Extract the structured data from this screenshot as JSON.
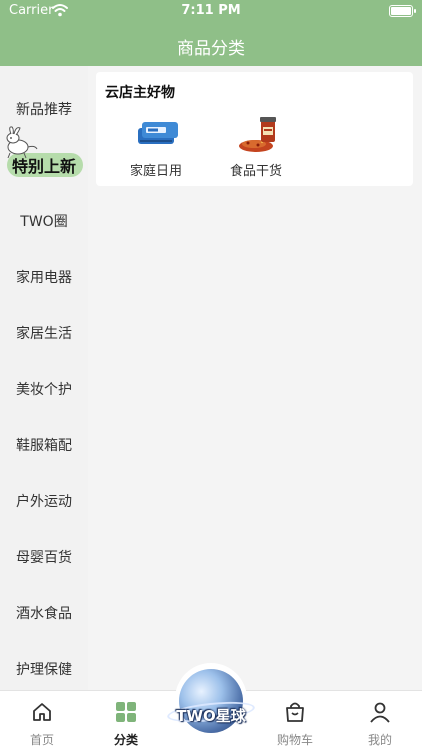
{
  "status_bar": {
    "carrier": "Carrier",
    "time": "7:11 PM"
  },
  "nav": {
    "title": "商品分类"
  },
  "sidebar": {
    "items": [
      {
        "label": "新品推荐",
        "active": false
      },
      {
        "label": "特别上新",
        "active": true
      },
      {
        "label": "TWO圈",
        "active": false
      },
      {
        "label": "家用电器",
        "active": false
      },
      {
        "label": "家居生活",
        "active": false
      },
      {
        "label": "美妆个护",
        "active": false
      },
      {
        "label": "鞋服箱配",
        "active": false
      },
      {
        "label": "户外运动",
        "active": false
      },
      {
        "label": "母婴百货",
        "active": false
      },
      {
        "label": "酒水食品",
        "active": false
      },
      {
        "label": "护理保健",
        "active": false
      }
    ]
  },
  "section": {
    "title": "云店主好物",
    "categories": [
      {
        "name": "家庭日用",
        "icon": "tissue-pack-icon"
      },
      {
        "name": "食品干货",
        "icon": "chili-sauce-icon"
      }
    ]
  },
  "tabbar": {
    "tabs": [
      {
        "label": "首页",
        "icon": "home-icon",
        "active": false
      },
      {
        "label": "分类",
        "icon": "grid-icon",
        "active": true
      },
      {
        "label": "购物车",
        "icon": "shopping-bag-icon",
        "active": false
      },
      {
        "label": "我的",
        "icon": "user-icon",
        "active": false
      }
    ],
    "center": {
      "label": "TWO星球",
      "icon": "planet-icon"
    }
  },
  "colors": {
    "brand": "#8fbf88",
    "active_highlight": "#b6dcab",
    "active_tab_icon": "#7fb47a"
  }
}
